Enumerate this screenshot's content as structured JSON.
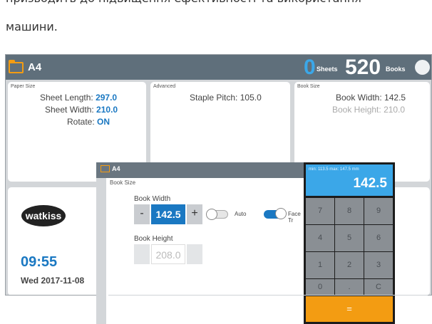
{
  "doc": {
    "line1": "призводить до підвищення ефективності та використання",
    "line2": "машини."
  },
  "topbar": {
    "paper_name": "A4",
    "sheets_count": "0",
    "sheets_label": "Sheets",
    "books_count": "520",
    "books_label": "Books"
  },
  "paper_size": {
    "title": "Paper Size",
    "length_label": "Sheet Length:",
    "length_value": "297.0",
    "width_label": "Sheet Width:",
    "width_value": "210.0",
    "rotate_label": "Rotate:",
    "rotate_value": "ON"
  },
  "advanced": {
    "title": "Advanced",
    "staple_label": "Staple Pitch:",
    "staple_value": "105.0"
  },
  "book_size_panel": {
    "title": "Book Size",
    "width_label": "Book Width:",
    "width_value": "142.5",
    "height_label": "Book Height:",
    "height_value": "210.0"
  },
  "home": {
    "logo_text": "watkiss",
    "time": "09:55",
    "date": "Wed 2017-11-08"
  },
  "dialog": {
    "bar_title": "A4",
    "title": "Book Size",
    "book_width_label": "Book Width",
    "book_width_value": "142.5",
    "minus": "-",
    "plus": "+",
    "auto_label": "Auto",
    "face_label": "Face Tr",
    "book_height_label": "Book Height",
    "book_height_value": "208.0"
  },
  "keypad": {
    "range": "min: 113.5  max: 147.5 mm",
    "value": "142.5",
    "keys": [
      "7",
      "8",
      "9",
      "4",
      "5",
      "6",
      "1",
      "2",
      "3",
      "0",
      ".",
      "C"
    ],
    "enter": "="
  },
  "colors": {
    "accent": "#1a78c2",
    "highlight": "#3ba7e8",
    "orange": "#f39c12",
    "bar": "#5f6f7b"
  }
}
